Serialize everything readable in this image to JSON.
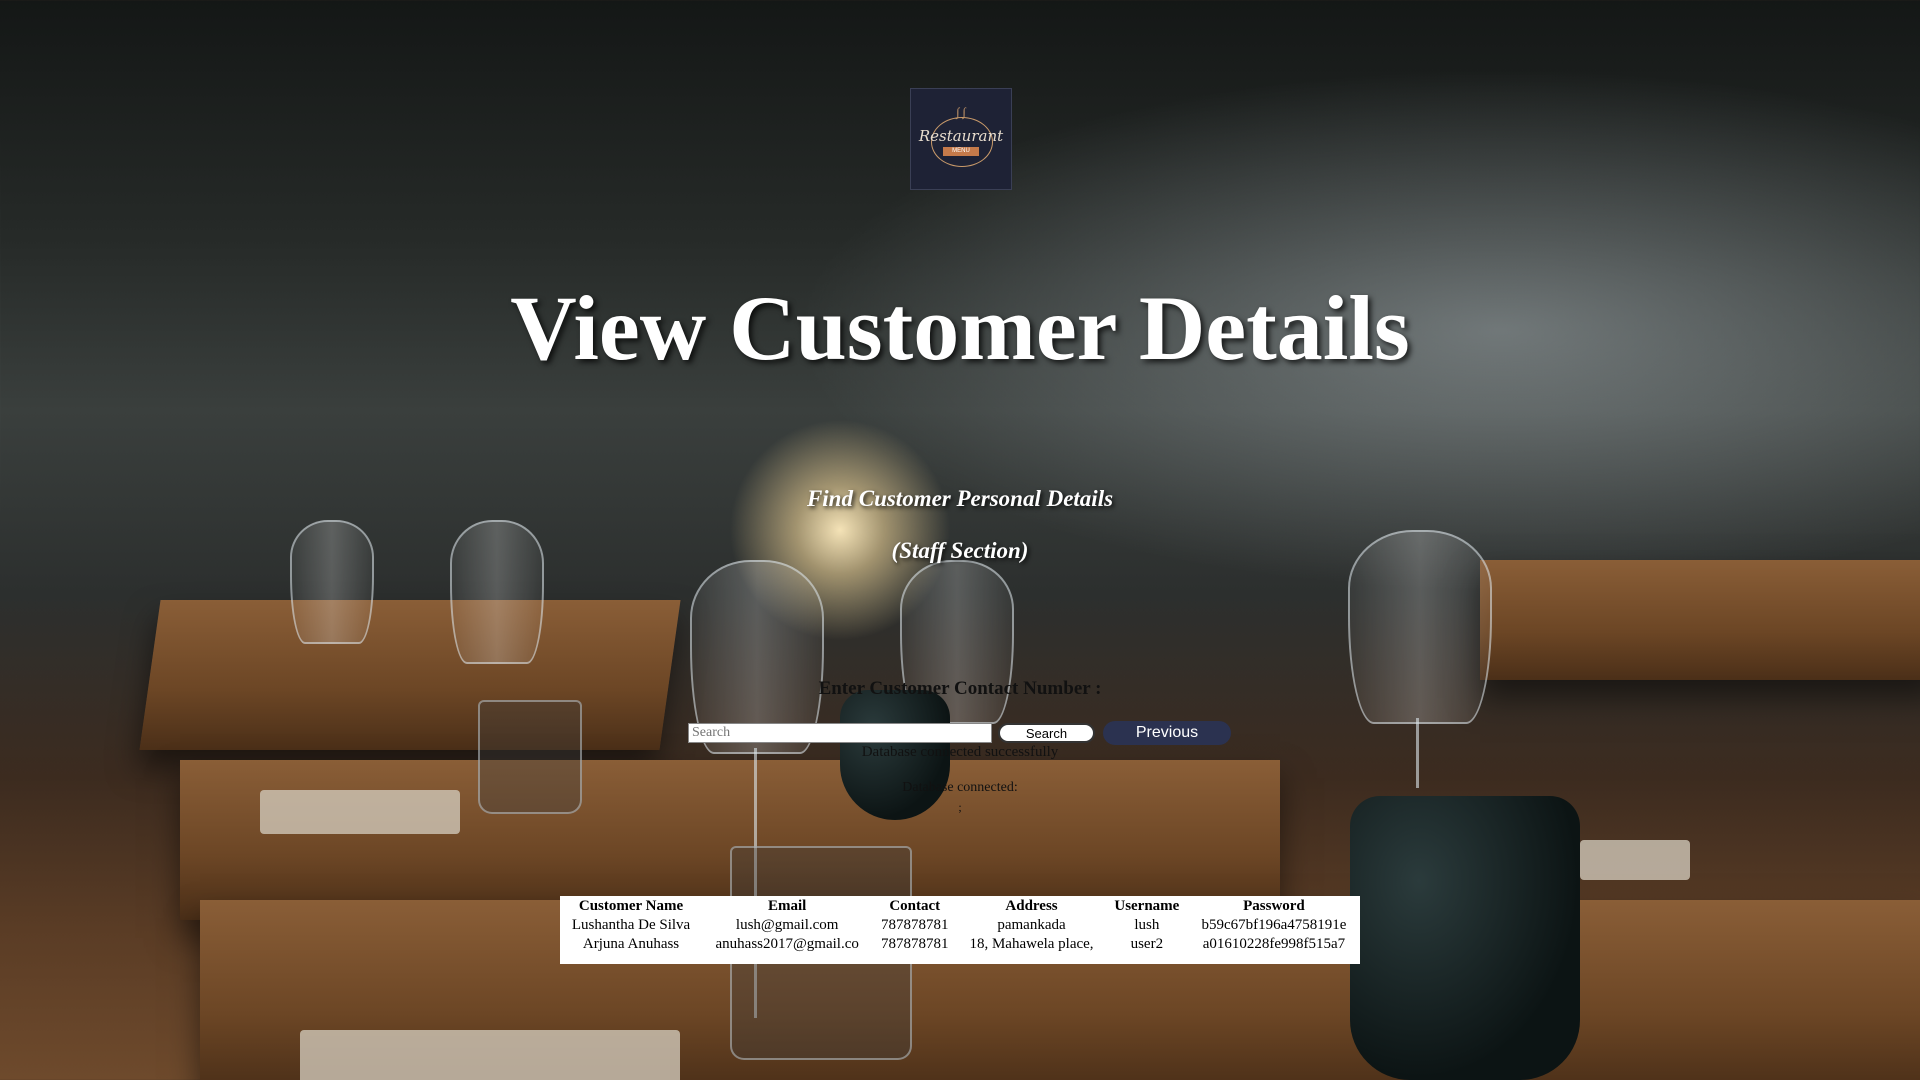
{
  "logo": {
    "name": "Restaurant",
    "tag": "MENU"
  },
  "page_title": "View Customer Details",
  "subtitle_line1": "Find Customer Personal Details",
  "subtitle_line2": "(Staff Section)",
  "search": {
    "label": "Enter Customer Contact Number :",
    "placeholder": "Search",
    "search_button": "Search",
    "previous_button": "Previous"
  },
  "status": {
    "line1": "Database connected successfully",
    "line2": "Database connected:",
    "line3": ";"
  },
  "table": {
    "headers": [
      "Customer Name",
      "Email",
      "Contact",
      "Address",
      "Username",
      "Password"
    ],
    "rows": [
      [
        "Lushantha De Silva",
        "lush@gmail.com",
        "787878781",
        "pamankada",
        "lush",
        "b59c67bf196a4758191e"
      ],
      [
        "Arjuna Anuhass",
        "anuhass2017@gmail.co",
        "787878781",
        "18, Mahawela place,",
        "user2",
        "a01610228fe998f515a7"
      ]
    ]
  }
}
